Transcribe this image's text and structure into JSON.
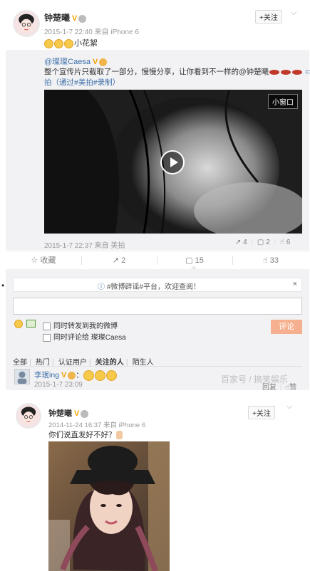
{
  "post1": {
    "username": "钟楚曦",
    "verified_badge": "V",
    "timestamp": "2015-1-7 22:40",
    "source": "来自 iPhone 6",
    "follow_label": "+关注",
    "text": "小花絮",
    "retweet": {
      "author": "@璨璨Caesa",
      "verified_badge": "V",
      "text_line1": "整个宣传片只截取了一部分，慢慢分享，让你看到不一样的@钟楚曦",
      "app_tag": "美",
      "text_line2": "拍（通过#美拍#录制）",
      "video_overlay_label": "小窗口",
      "timestamp": "2015-1-7 22:37",
      "source": "来自 美拍",
      "repost_count": "4",
      "comment_count": "2",
      "like_count": "6"
    },
    "toolbar": {
      "favorite": "收藏",
      "repost": "2",
      "comment": "15",
      "like": "33"
    },
    "comment_panel": {
      "notice": "#微博辟谣#平台，欢迎查阅！",
      "notice_close": "×",
      "input_value": "",
      "option_forward": "同时转发到我的微博",
      "option_comment_to": "同时评论给 璨璨Caesa",
      "submit_label": "评论",
      "filters": [
        "全部",
        "热门",
        "认证用户",
        "关注的人",
        "陌生人"
      ],
      "active_filter": "关注的人"
    },
    "comment": {
      "author": "李珉ing",
      "verified_badge": "V",
      "timestamp": "2015-1-7 23:09",
      "reply_label": "回复",
      "like_label": "赞"
    },
    "watermark": "百家号 / 搞笑娱乐"
  },
  "post2": {
    "username": "钟楚曦",
    "verified_badge": "V",
    "timestamp": "2014-11-24 16:37",
    "source": "来自 iPhone 6",
    "follow_label": "+关注",
    "text": "你们说直发好不好？"
  },
  "colors": {
    "accent_orange": "#eb7350",
    "link_blue": "#3c6ea6",
    "submit_bg": "#f7b08f",
    "verified_gold": "#f2a100"
  }
}
